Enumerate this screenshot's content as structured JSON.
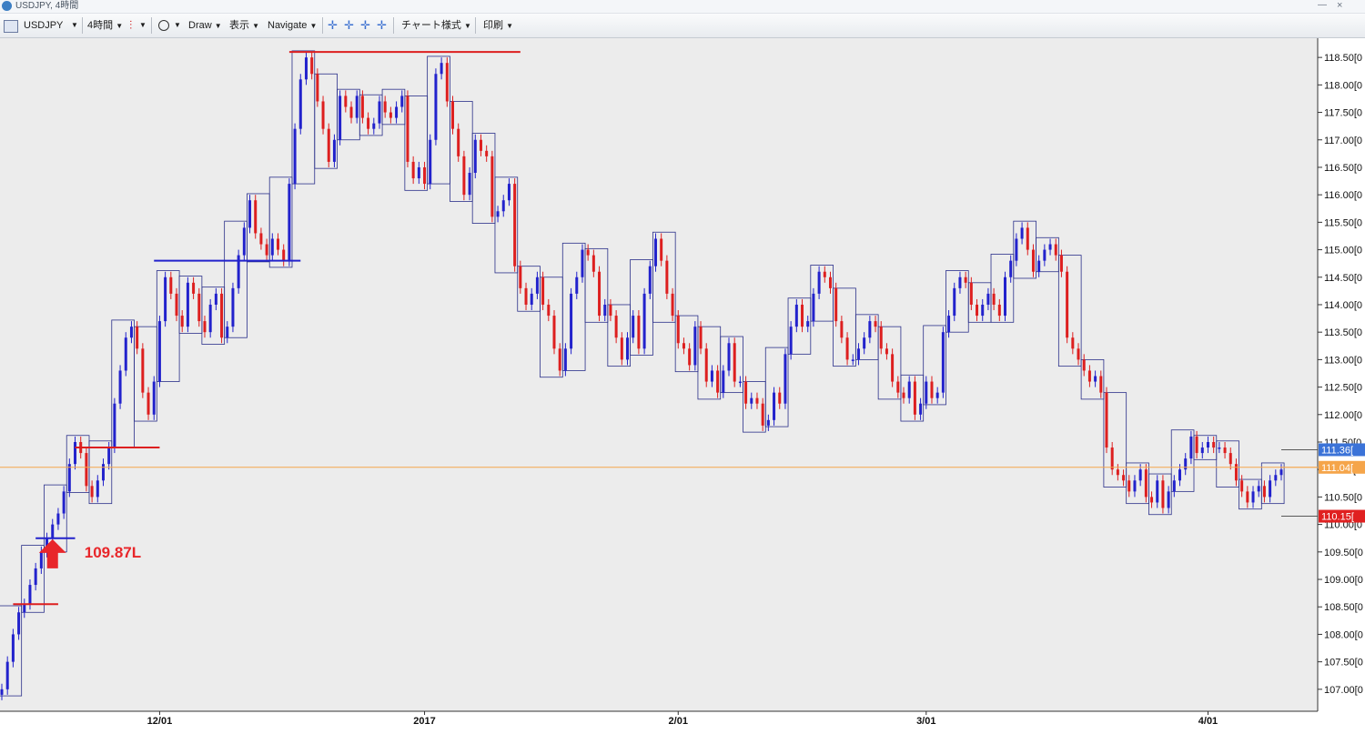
{
  "window": {
    "title": "USDJPY, 4時間",
    "minimize_glyph": "—",
    "close_glyph": "×"
  },
  "toolbar": {
    "symbol": "USDJPY",
    "dropdown_glyph": "▼",
    "timeframe": "4時間",
    "draw": "Draw",
    "view": "表示",
    "navigate": "Navigate",
    "chart_style": "チャート様式",
    "print": "印刷",
    "icons": [
      "chart-icon",
      "candlestick-icon",
      "circle-tool-icon",
      "crosshair-icon",
      "crosshair-icon",
      "crosshair-icon",
      "crosshair-icon"
    ]
  },
  "colors": {
    "plot_bg": "#ececec",
    "axis_bg": "#ffffff",
    "bull": "#2222cc",
    "bear": "#dd1f1f",
    "box": "#2a2f8a",
    "current_line": "#f5a54a",
    "high_tag": "#3b73d8",
    "current_tag": "#f5a54a",
    "low_tag": "#e02020",
    "annotation": "#e8262a"
  },
  "annotation": {
    "text": "109.87L"
  },
  "chart_data": {
    "type": "candlestick",
    "symbol": "USDJPY",
    "timeframe": "4時間",
    "ylim": [
      106.6,
      118.85
    ],
    "y_ticks": [
      "118.50[0",
      "118.00[0",
      "117.50[0",
      "117.00[0",
      "116.50[0",
      "116.00[0",
      "115.50[0",
      "115.00[0",
      "114.50[0",
      "114.00[0",
      "113.50[0",
      "113.00[0",
      "112.50[0",
      "112.00[0",
      "111.50[0",
      "111.00[0",
      "110.50[0",
      "110.00[0",
      "109.50[0",
      "109.00[0",
      "108.50[0",
      "108.00[0",
      "107.50[0",
      "107.00[0"
    ],
    "y_tick_values": [
      118.5,
      118.0,
      117.5,
      117.0,
      116.5,
      116.0,
      115.5,
      115.0,
      114.5,
      114.0,
      113.5,
      113.0,
      112.5,
      112.0,
      111.5,
      111.0,
      110.5,
      110.0,
      109.5,
      109.0,
      108.5,
      108.0,
      107.5,
      107.0
    ],
    "x_ticks": [
      {
        "label": "12/01",
        "index": 28
      },
      {
        "label": "2017",
        "index": 75
      },
      {
        "label": "2/01",
        "index": 120
      },
      {
        "label": "3/01",
        "index": 164
      },
      {
        "label": "4/01",
        "index": 214
      }
    ],
    "price_tags": [
      {
        "label": "111.36[",
        "value": 111.36,
        "kind": "high"
      },
      {
        "label": "111.04[",
        "value": 111.04,
        "kind": "current"
      },
      {
        "label": "110.15[",
        "value": 110.15,
        "kind": "low"
      }
    ],
    "current_price": 111.04,
    "horizontal_lines": [
      {
        "value": 108.55,
        "from": 2,
        "to": 10,
        "color": "red"
      },
      {
        "value": 109.75,
        "from": 6,
        "to": 13,
        "color": "blue"
      },
      {
        "value": 111.4,
        "from": 13,
        "to": 28,
        "color": "red"
      },
      {
        "value": 114.8,
        "from": 27,
        "to": 53,
        "color": "blue"
      },
      {
        "value": 118.6,
        "from": 51,
        "to": 92,
        "color": "red"
      }
    ],
    "arrow_index": 9,
    "closes": [
      107,
      107.5,
      108,
      108.4,
      108.55,
      108.9,
      109.2,
      109.5,
      109.75,
      110.0,
      110.2,
      110.6,
      111.1,
      111.5,
      111.3,
      110.7,
      110.5,
      110.8,
      111.1,
      111.4,
      112.2,
      112.8,
      113.4,
      113.6,
      113.2,
      112.4,
      112.0,
      112.6,
      113.7,
      114.5,
      114.2,
      113.8,
      113.6,
      114.4,
      114.2,
      113.7,
      113.5,
      114.0,
      114.2,
      113.4,
      113.6,
      114.3,
      114.9,
      115.4,
      115.9,
      115.3,
      115.1,
      114.9,
      115.2,
      115.0,
      114.8,
      116.2,
      117.2,
      118.1,
      118.5,
      118.2,
      117.7,
      117.2,
      116.6,
      117.0,
      117.8,
      117.6,
      117.4,
      117.8,
      117.4,
      117.2,
      117.3,
      117.7,
      117.5,
      117.4,
      117.6,
      117.8,
      116.6,
      116.3,
      116.5,
      116.2,
      117.0,
      118.2,
      118.4,
      117.7,
      117.2,
      116.7,
      116.0,
      116.4,
      117.0,
      116.8,
      116.7,
      115.6,
      115.7,
      115.9,
      116.2,
      114.7,
      114.3,
      114.0,
      114.2,
      114.5,
      114.0,
      113.8,
      113.2,
      112.8,
      113.2,
      114.2,
      114.5,
      115.0,
      114.9,
      114.6,
      113.8,
      114.0,
      113.8,
      113.4,
      113.0,
      113.4,
      113.8,
      113.2,
      114.2,
      114.7,
      115.2,
      114.8,
      114.2,
      113.8,
      113.3,
      113.2,
      112.9,
      113.6,
      113.2,
      112.6,
      112.8,
      112.4,
      112.8,
      113.3,
      112.6,
      112.6,
      112.2,
      112.3,
      112.2,
      111.8,
      111.9,
      112.4,
      112.2,
      113.1,
      113.6,
      114.0,
      113.6,
      113.7,
      114.2,
      114.6,
      114.5,
      114.3,
      113.7,
      113.4,
      113.0,
      113.0,
      113.2,
      113.4,
      113.7,
      113.6,
      113.2,
      113.1,
      112.6,
      112.4,
      112.3,
      112.6,
      112.0,
      112.2,
      112.6,
      112.3,
      112.4,
      113.5,
      113.8,
      114.3,
      114.5,
      114.4,
      114.0,
      113.8,
      114.0,
      114.2,
      114.0,
      113.8,
      114.5,
      114.8,
      115.2,
      115.4,
      115.0,
      114.6,
      114.8,
      115.0,
      115.1,
      114.9,
      114.6,
      113.4,
      113.2,
      113.0,
      112.8,
      112.6,
      112.7,
      112.4,
      111.4,
      111.0,
      110.9,
      110.8,
      110.6,
      110.8,
      111.0,
      110.5,
      110.4,
      110.8,
      110.3,
      110.6,
      110.8,
      111.0,
      111.2,
      111.6,
      111.3,
      111.4,
      111.5,
      111.4,
      111.4,
      111.3,
      111.1,
      110.8,
      110.6,
      110.4,
      110.6,
      110.7,
      110.5,
      110.8,
      110.9,
      111.0
    ]
  }
}
